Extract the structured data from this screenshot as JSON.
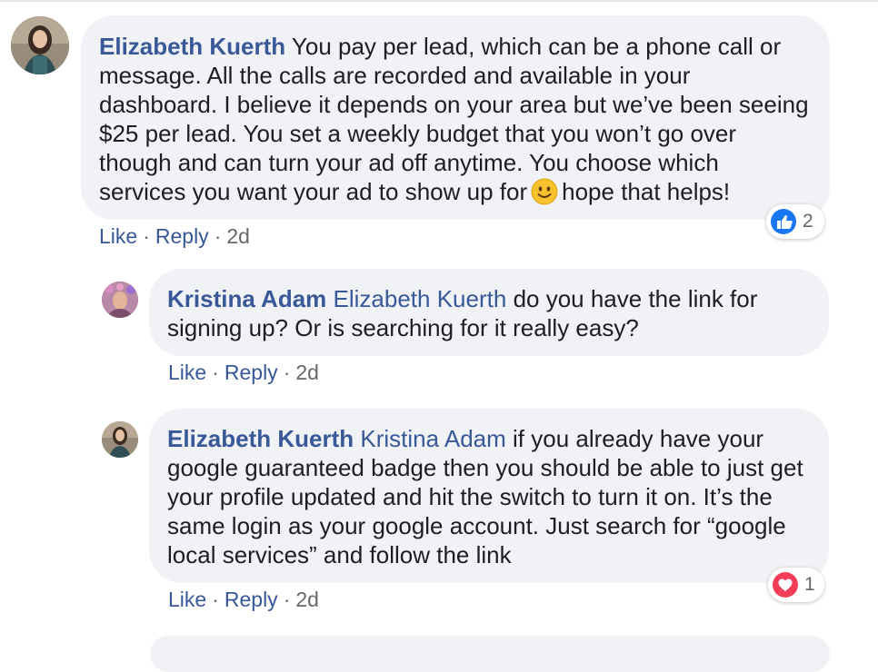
{
  "comments": [
    {
      "author": "Elizabeth Kuerth",
      "mention": "",
      "text_before_emoji": "You pay per lead, which can be a phone call or message. All the calls are recorded and available in your dashboard. I believe it depends on your area but we’ve been seeing $25 per lead. You set a weekly budget that you won’t go over though and can turn your ad off anytime. You choose which services you want your ad to show up for",
      "emoji": "slightly-smiling-face-icon",
      "text_after_emoji": "hope that helps!",
      "actions": {
        "like": "Like",
        "reply": "Reply",
        "time": "2d"
      },
      "reaction": {
        "type": "like-reaction-icon",
        "count": "2",
        "color": "#1877f2"
      }
    },
    {
      "author": "Kristina Adam",
      "mention": "Elizabeth Kuerth",
      "text": "do you have the link for signing up? Or is searching for it really easy?",
      "actions": {
        "like": "Like",
        "reply": "Reply",
        "time": "2d"
      }
    },
    {
      "author": "Elizabeth Kuerth",
      "mention": "Kristina Adam",
      "text": "if you already have your google guaranteed badge then you should be able to just get your profile updated and hit the switch to turn it on. It’s the same login as your google account. Just search for “google local services” and follow the link",
      "actions": {
        "like": "Like",
        "reply": "Reply",
        "time": "2d"
      },
      "reaction": {
        "type": "love-reaction-icon",
        "count": "1",
        "color": "#f33e58"
      }
    }
  ],
  "separator": "·",
  "colors": {
    "link": "#385898",
    "bubble": "#f0f2f5",
    "meta": "#65676b"
  }
}
